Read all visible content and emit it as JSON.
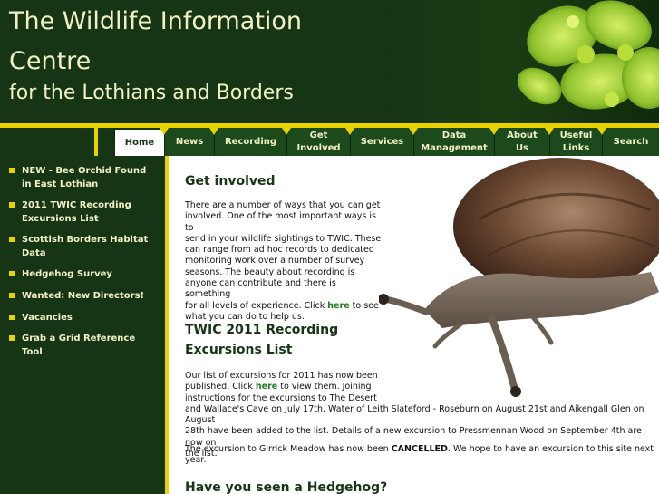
{
  "header": {
    "title_line1": "The Wildlife Information",
    "title_line2": "Centre",
    "subtitle": "for the Lothians and Borders"
  },
  "nav": {
    "tabs": [
      {
        "line1": "Home",
        "line2": "",
        "active": true
      },
      {
        "line1": "News",
        "line2": ""
      },
      {
        "line1": "Recording",
        "line2": ""
      },
      {
        "line1": "Get",
        "line2": "Involved"
      },
      {
        "line1": "Services",
        "line2": ""
      },
      {
        "line1": "Data",
        "line2": "Management"
      },
      {
        "line1": "About",
        "line2": "Us"
      },
      {
        "line1": "Useful",
        "line2": "Links"
      },
      {
        "line1": "Search",
        "line2": ""
      }
    ]
  },
  "sidebar": {
    "items": [
      {
        "line1": "NEW - Bee Orchid Found",
        "line2": "in East Lothian"
      },
      {
        "line1": "2011 TWIC Recording",
        "line2": "Excursions List"
      },
      {
        "line1": "Scottish Borders Habitat",
        "line2": "Data"
      },
      {
        "line1": "Hedgehog Survey",
        "line2": ""
      },
      {
        "line1": "Wanted: New Directors!",
        "line2": ""
      },
      {
        "line1": "Vacancies",
        "line2": ""
      },
      {
        "line1": "Grab a Grid Reference",
        "line2": "Tool"
      }
    ]
  },
  "content": {
    "section1": {
      "heading": "Get involved",
      "lines": [
        "There are a number of ways that you can get",
        "involved. One of the most important ways is to",
        "send in your wildlife sightings to TWIC. These",
        "can range from ad hoc records to dedicated",
        "monitoring work over a number of survey",
        "seasons. The beauty about recording is",
        "anyone can contribute and there is something"
      ],
      "line8_before": "for all levels of experience. Click ",
      "link": "here",
      "line8_after": " to see",
      "line9": "what you can do to help us."
    },
    "section2": {
      "heading_line1": "TWIC 2011 Recording",
      "heading_line2": "Excursions List",
      "line1": "Our list of excursions for 2011 has now been",
      "line2_before": "published. Click ",
      "link": "here",
      "line2_after": " to view them. Joining",
      "line3": "instructions for the excursions to The Desert",
      "line4": "and Wallace's Cave on July 17th, Water of Leith Slateford - Roseburn on August 21st and Aikengall Glen on August",
      "line5": "28th have been added to the list. Details of a new excursion to Pressmennan Wood on September 4th are now on",
      "line6": "the list.",
      "cancel_before": "The excursion to Girrick Meadow has now been ",
      "cancel_bold": "CANCELLED",
      "cancel_after": ". We hope to have an excursion to this site next year."
    },
    "section3": {
      "heading": "Have you seen a Hedgehog?"
    }
  },
  "colors": {
    "dark_green": "#153515",
    "gold": "#e8d200",
    "cream_text": "#f3f0c6",
    "link_green": "#1f7a1f"
  }
}
